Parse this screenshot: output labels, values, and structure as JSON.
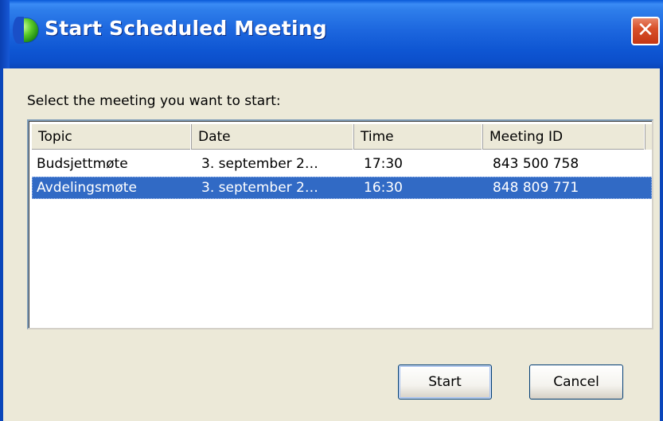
{
  "window": {
    "title": "Start Scheduled Meeting",
    "close_label": "✕",
    "accent_color": "#0C4FCB",
    "selection_color": "#316AC5"
  },
  "prompt": "Select the meeting you want to start:",
  "list": {
    "columns": [
      "Topic",
      "Date",
      "Time",
      "Meeting ID"
    ],
    "rows": [
      {
        "topic": "Budsjettmøte",
        "date": "3. september 2…",
        "time": "17:30",
        "meeting_id": "843 500 758",
        "selected": false
      },
      {
        "topic": "Avdelingsmøte",
        "date": "3. september 2…",
        "time": "16:30",
        "meeting_id": "848 809 771",
        "selected": true
      }
    ]
  },
  "buttons": {
    "start": "Start",
    "cancel": "Cancel"
  }
}
